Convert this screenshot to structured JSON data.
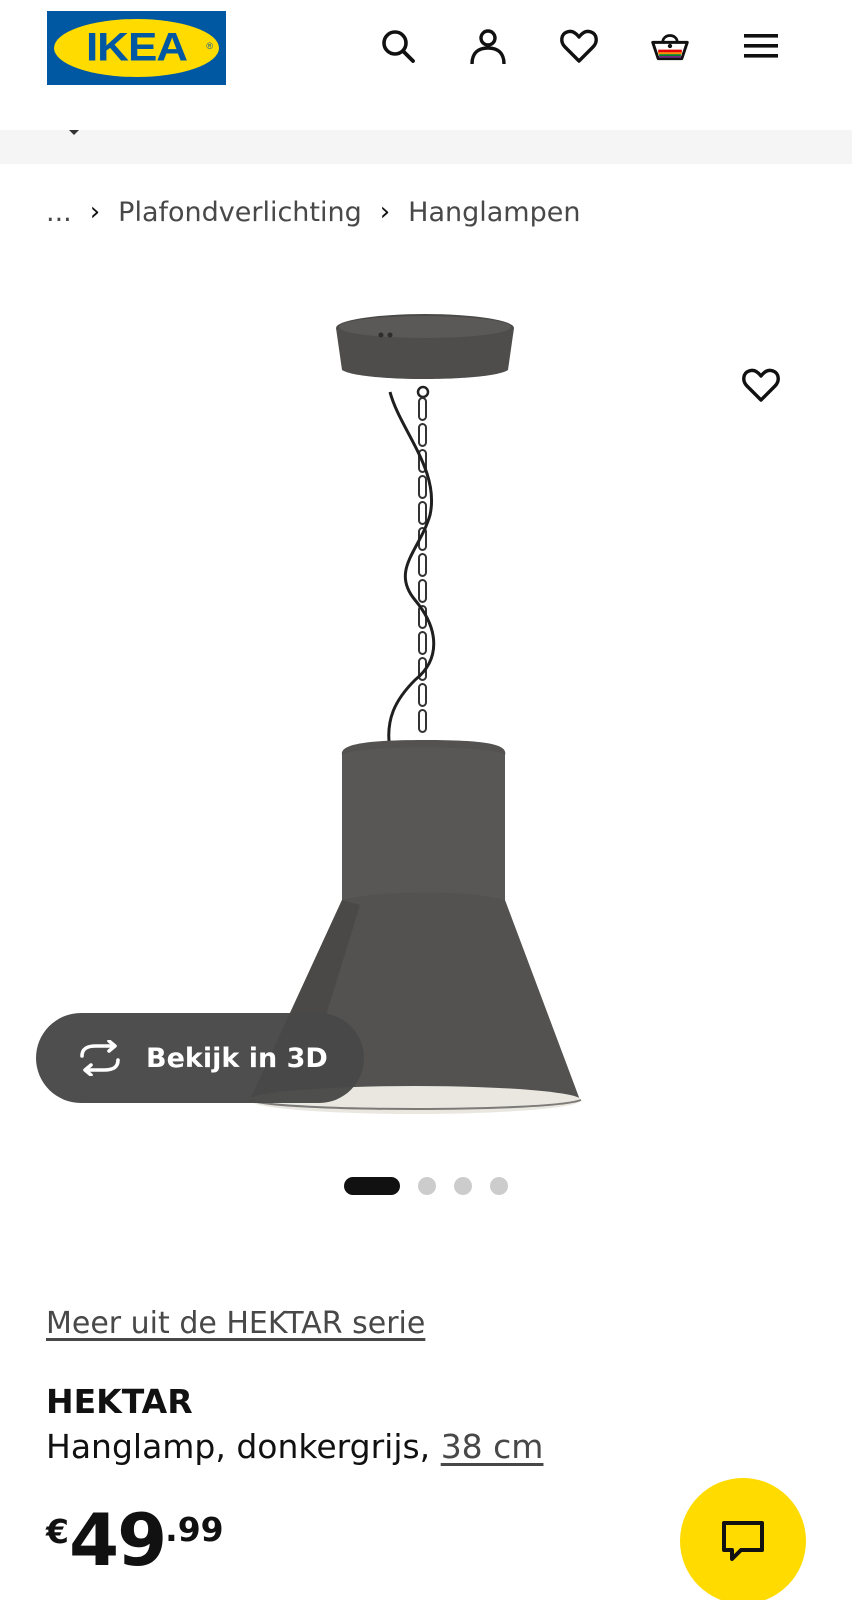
{
  "header": {
    "logo_text": "IKEA",
    "icons": [
      "search-icon",
      "account-icon",
      "heart-icon",
      "basket-icon",
      "menu-icon"
    ]
  },
  "breadcrumb": {
    "ellipsis": "...",
    "items": [
      "Plafondverlichting",
      "Hanglampen"
    ]
  },
  "gallery": {
    "view_3d_label": "Bekijk in 3D",
    "image_count": 4,
    "active_index": 0
  },
  "product": {
    "series_link": "Meer uit de HEKTAR serie",
    "name": "HEKTAR",
    "description": "Hanglamp, donkergrijs,",
    "size": "38 cm",
    "price": {
      "currency": "€",
      "integer": "49",
      "decimals": ".99"
    }
  },
  "colors": {
    "ikea_blue": "#0058a3",
    "ikea_yellow": "#ffdb00",
    "lamp_grey": "#4e4d4b"
  }
}
